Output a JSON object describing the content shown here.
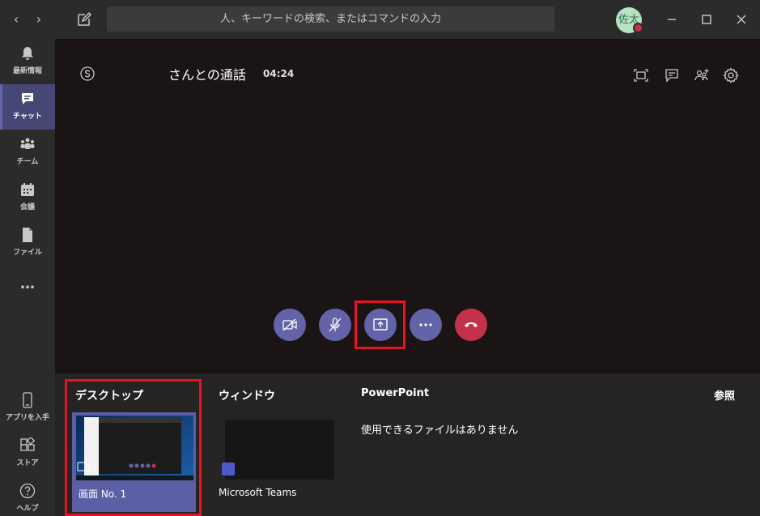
{
  "titlebar": {
    "search_placeholder": "人、キーワードの検索、またはコマンドの入力",
    "avatar_initials": "佐太"
  },
  "rail": {
    "items": [
      {
        "label": "最新情報",
        "icon": "bell-icon"
      },
      {
        "label": "チャット",
        "icon": "chat-icon",
        "active": true
      },
      {
        "label": "チーム",
        "icon": "teams-icon"
      },
      {
        "label": "会議",
        "icon": "calendar-icon"
      },
      {
        "label": "ファイル",
        "icon": "file-icon"
      },
      {
        "label": "…",
        "icon": "more-icon"
      }
    ],
    "bottom": [
      {
        "label": "アプリを入手",
        "icon": "phone-icon"
      },
      {
        "label": "ストア",
        "icon": "store-icon"
      },
      {
        "label": "ヘルプ",
        "icon": "help-icon"
      }
    ]
  },
  "call": {
    "title": "さんとの通話",
    "timer": "04:24"
  },
  "tray": {
    "desktop_heading": "デスクトップ",
    "window_heading": "ウィンドウ",
    "powerpoint_heading": "PowerPoint",
    "browse_label": "参照",
    "screen_label": "画面 No. 1",
    "window_label": "Microsoft Teams",
    "no_files_text": "使用できるファイルはありません"
  },
  "colors": {
    "accent": "#6264a7",
    "hangup": "#c4314b",
    "highlight": "#e81123"
  }
}
